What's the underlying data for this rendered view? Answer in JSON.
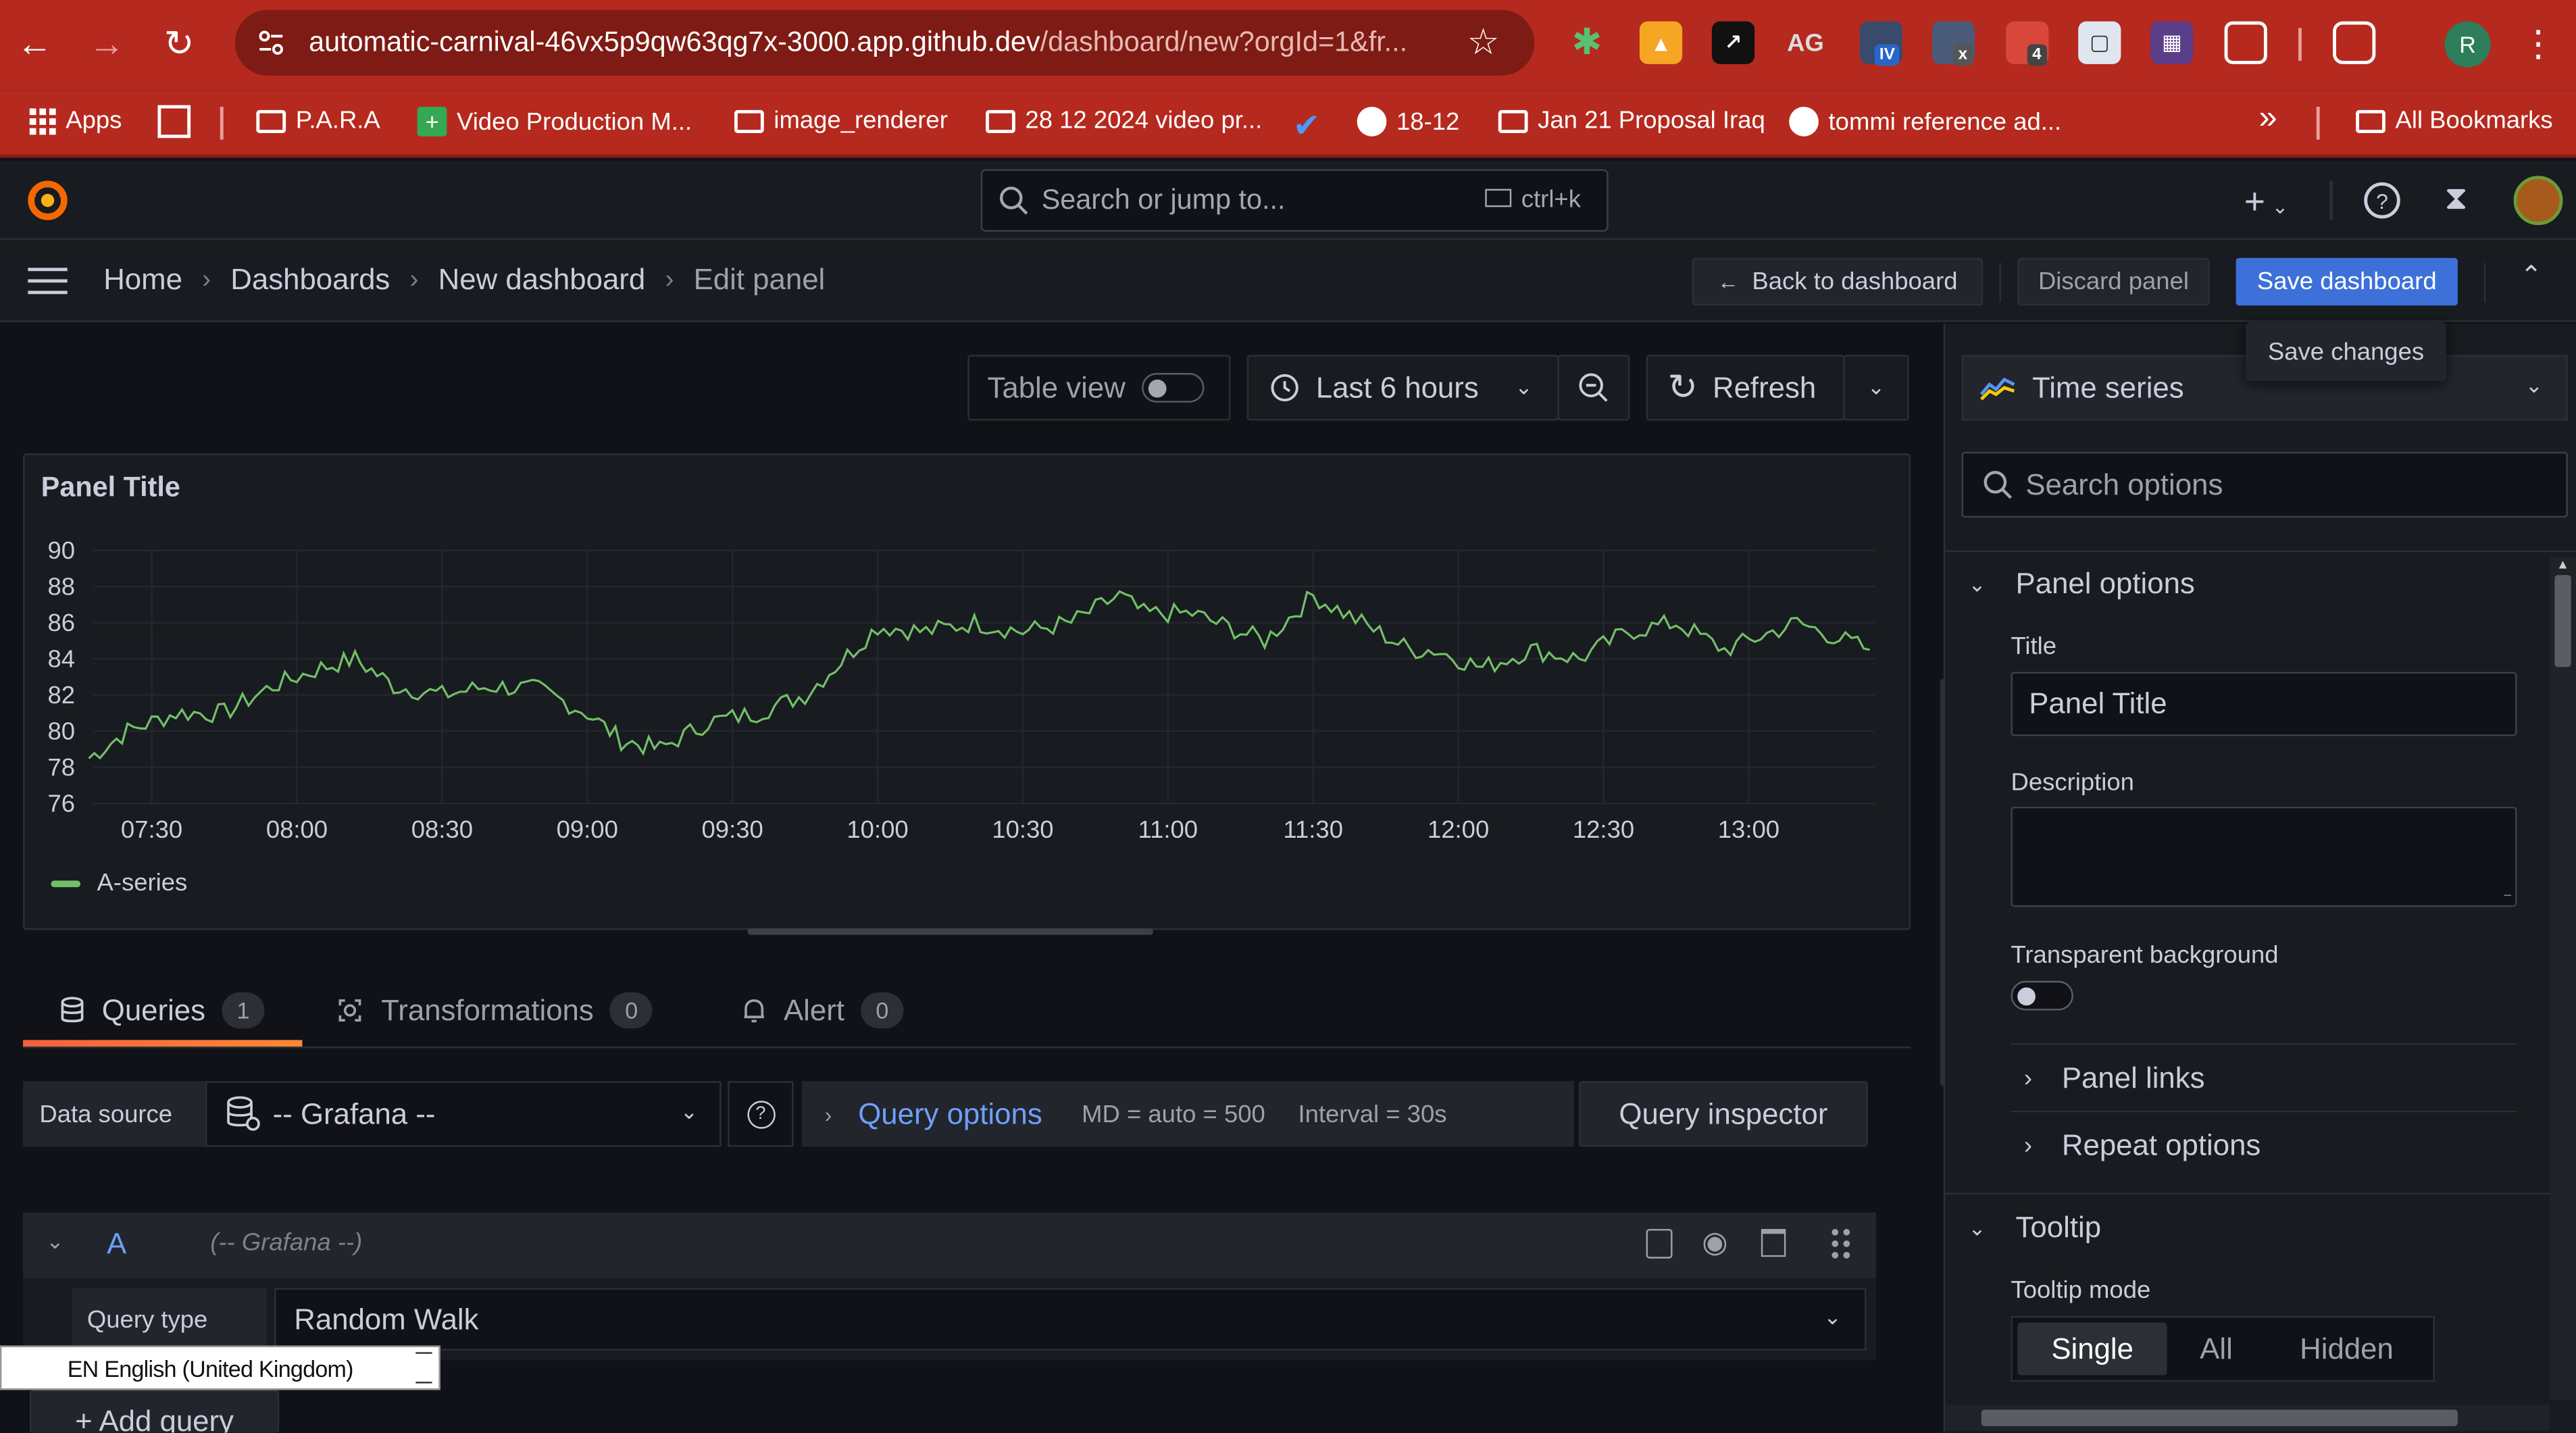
{
  "browser": {
    "url_main": "automatic-carnival-46vx5p9qw63qg7x-3000.app.github.dev",
    "url_rest": "/dashboard/new?orgId=1&fr...",
    "extensions": {
      "ext5_badge": "IV",
      "ext6_badge": "x",
      "ext7_badge": "4"
    },
    "profile_initial": "R",
    "bookmarks": [
      {
        "label": "Apps"
      },
      {
        "label": "P.A.R.A"
      },
      {
        "label": "Video Production M..."
      },
      {
        "label": "image_renderer"
      },
      {
        "label": "28 12 2024 video pr..."
      },
      {
        "label": "18-12"
      },
      {
        "label": "Jan 21 Proposal Iraq"
      },
      {
        "label": "tommi reference ad..."
      }
    ],
    "all_bookmarks": "All Bookmarks",
    "overflow": "»"
  },
  "grafana": {
    "search_placeholder": "Search or jump to...",
    "search_shortcut": "ctrl+k",
    "breadcrumbs": [
      "Home",
      "Dashboards",
      "New dashboard",
      "Edit panel"
    ],
    "back_button": "Back to dashboard",
    "discard_button": "Discard panel",
    "save_button": "Save dashboard",
    "save_tooltip": "Save changes"
  },
  "toolbar": {
    "table_view": "Table view",
    "time_range": "Last 6 hours",
    "refresh": "Refresh"
  },
  "panel": {
    "title": "Panel Title",
    "legend": "A-series"
  },
  "chart_data": {
    "type": "line",
    "title": "Panel Title",
    "ylim": [
      76,
      90
    ],
    "y_ticks": [
      "90",
      "88",
      "86",
      "84",
      "82",
      "80",
      "78",
      "76"
    ],
    "x_ticks": [
      "07:30",
      "08:00",
      "08:30",
      "09:00",
      "09:30",
      "10:00",
      "10:30",
      "11:00",
      "11:30",
      "12:00",
      "12:30",
      "13:00"
    ],
    "series": [
      {
        "name": "A-series",
        "color": "#73bf69",
        "x": [
          "07:17",
          "07:25",
          "07:35",
          "07:45",
          "07:55",
          "08:05",
          "08:12",
          "08:20",
          "08:30",
          "08:40",
          "08:50",
          "09:00",
          "09:07",
          "09:15",
          "09:25",
          "09:35",
          "09:45",
          "09:55",
          "10:00",
          "10:10",
          "10:20",
          "10:30",
          "10:40",
          "10:50",
          "10:55",
          "11:05",
          "11:15",
          "11:20",
          "11:30",
          "11:40",
          "11:50",
          "11:55",
          "12:05",
          "12:15",
          "12:25",
          "12:35",
          "12:45",
          "12:55",
          "13:00",
          "13:10",
          "13:20",
          "13:25"
        ],
        "values": [
          78.5,
          80.0,
          81.0,
          81.0,
          82.5,
          83.5,
          84.0,
          82.5,
          82.0,
          82.5,
          82.3,
          81.0,
          79.5,
          79.0,
          80.5,
          81.0,
          82.0,
          84.5,
          85.8,
          85.5,
          86.0,
          85.5,
          86.0,
          87.5,
          86.5,
          86.5,
          85.5,
          85.0,
          87.5,
          86.0,
          84.5,
          84.5,
          83.5,
          84.5,
          84.0,
          85.5,
          86.0,
          84.5,
          85.0,
          86.0,
          85.0,
          84.5
        ]
      }
    ]
  },
  "query_tabs": [
    {
      "label": "Queries",
      "count": "1"
    },
    {
      "label": "Transformations",
      "count": "0"
    },
    {
      "label": "Alert",
      "count": "0"
    }
  ],
  "query": {
    "datasource_label": "Data source",
    "datasource_value": "-- Grafana --",
    "query_options": "Query options",
    "md": "MD = auto = 500",
    "interval": "Interval = 30s",
    "query_inspector": "Query inspector",
    "ref_id": "A",
    "ref_source": "(-- Grafana --)",
    "query_type_label": "Query type",
    "query_type_value": "Random Walk",
    "add_query": "+ Add query"
  },
  "ime": {
    "label": "EN English (United Kingdom)"
  },
  "options": {
    "viz": "Time series",
    "search_placeholder": "Search options",
    "panel_options": "Panel options",
    "title_label": "Title",
    "title_value": "Panel Title",
    "description_label": "Description",
    "transparent_label": "Transparent background",
    "panel_links": "Panel links",
    "repeat_options": "Repeat options",
    "tooltip": "Tooltip",
    "tooltip_mode_label": "Tooltip mode",
    "tooltip_modes": [
      "Single",
      "All",
      "Hidden"
    ]
  }
}
